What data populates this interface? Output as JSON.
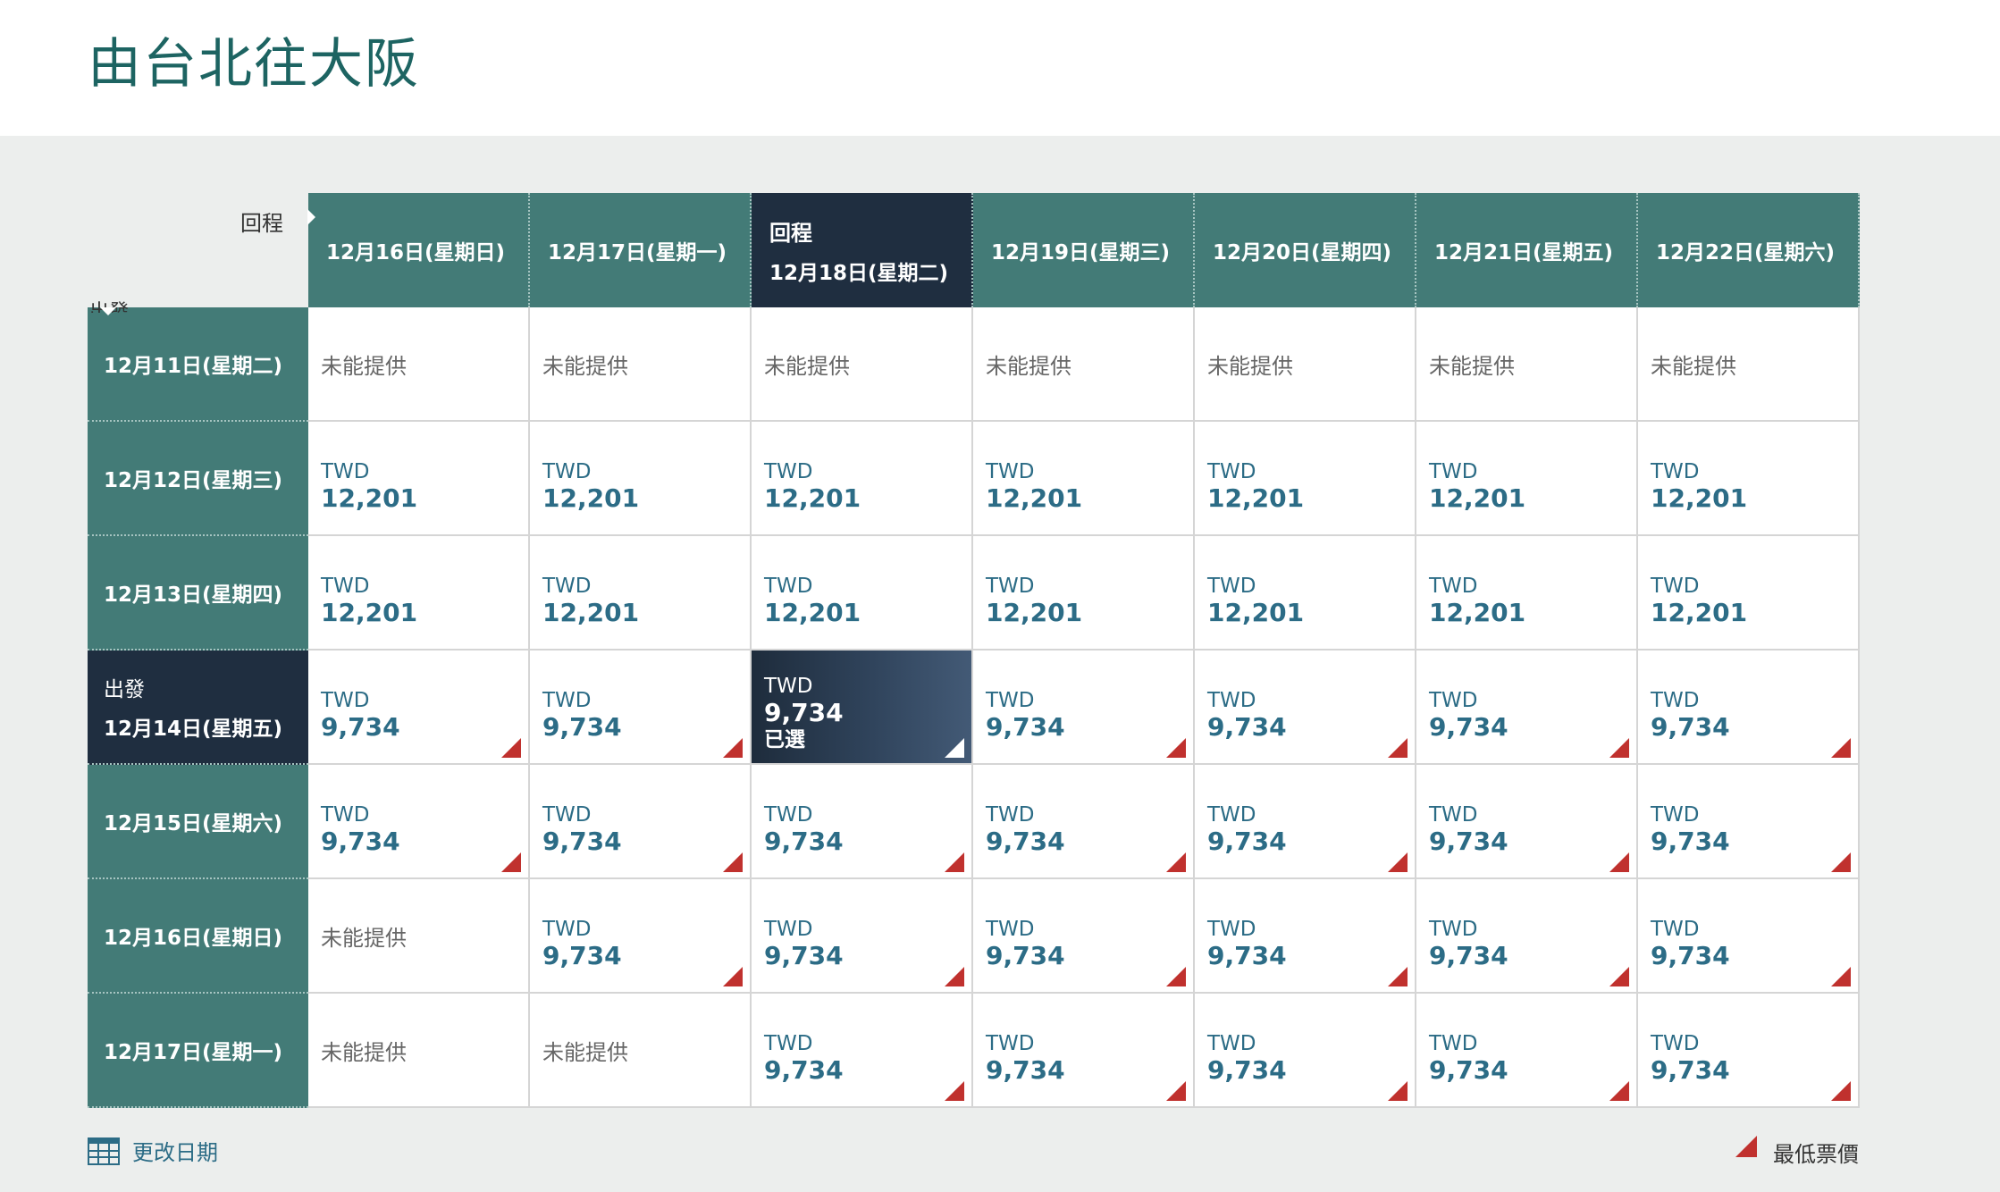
{
  "title": "由台北往大阪",
  "corner": {
    "return_label": "回程",
    "depart_label": "出發"
  },
  "return_dates": [
    {
      "date": "12月16日(星期日)",
      "selected": false
    },
    {
      "date": "12月17日(星期一)",
      "selected": false
    },
    {
      "date": "12月18日(星期二)",
      "selected": true
    },
    {
      "date": "12月19日(星期三)",
      "selected": false
    },
    {
      "date": "12月20日(星期四)",
      "selected": false
    },
    {
      "date": "12月21日(星期五)",
      "selected": false
    },
    {
      "date": "12月22日(星期六)",
      "selected": false
    }
  ],
  "selected_col_tag": "回程",
  "selected_row_tag": "出發",
  "currency": "TWD",
  "na_text": "未能提供",
  "selected_text": "已選",
  "rows": [
    {
      "date": "12月11日(星期二)",
      "selected": false,
      "cells": [
        {
          "na": true
        },
        {
          "na": true
        },
        {
          "na": true
        },
        {
          "na": true
        },
        {
          "na": true
        },
        {
          "na": true
        },
        {
          "na": true
        }
      ]
    },
    {
      "date": "12月12日(星期三)",
      "selected": false,
      "cells": [
        {
          "price": "12,201",
          "lowest": false
        },
        {
          "price": "12,201",
          "lowest": false
        },
        {
          "price": "12,201",
          "lowest": false
        },
        {
          "price": "12,201",
          "lowest": false
        },
        {
          "price": "12,201",
          "lowest": false
        },
        {
          "price": "12,201",
          "lowest": false
        },
        {
          "price": "12,201",
          "lowest": false
        }
      ]
    },
    {
      "date": "12月13日(星期四)",
      "selected": false,
      "cells": [
        {
          "price": "12,201",
          "lowest": false
        },
        {
          "price": "12,201",
          "lowest": false
        },
        {
          "price": "12,201",
          "lowest": false
        },
        {
          "price": "12,201",
          "lowest": false
        },
        {
          "price": "12,201",
          "lowest": false
        },
        {
          "price": "12,201",
          "lowest": false
        },
        {
          "price": "12,201",
          "lowest": false
        }
      ]
    },
    {
      "date": "12月14日(星期五)",
      "selected": true,
      "cells": [
        {
          "price": "9,734",
          "lowest": true
        },
        {
          "price": "9,734",
          "lowest": true
        },
        {
          "price": "9,734",
          "lowest": true,
          "selected": true
        },
        {
          "price": "9,734",
          "lowest": true
        },
        {
          "price": "9,734",
          "lowest": true
        },
        {
          "price": "9,734",
          "lowest": true
        },
        {
          "price": "9,734",
          "lowest": true
        }
      ]
    },
    {
      "date": "12月15日(星期六)",
      "selected": false,
      "cells": [
        {
          "price": "9,734",
          "lowest": true
        },
        {
          "price": "9,734",
          "lowest": true
        },
        {
          "price": "9,734",
          "lowest": true
        },
        {
          "price": "9,734",
          "lowest": true
        },
        {
          "price": "9,734",
          "lowest": true
        },
        {
          "price": "9,734",
          "lowest": true
        },
        {
          "price": "9,734",
          "lowest": true
        }
      ]
    },
    {
      "date": "12月16日(星期日)",
      "selected": false,
      "cells": [
        {
          "na": true
        },
        {
          "price": "9,734",
          "lowest": true
        },
        {
          "price": "9,734",
          "lowest": true
        },
        {
          "price": "9,734",
          "lowest": true
        },
        {
          "price": "9,734",
          "lowest": true
        },
        {
          "price": "9,734",
          "lowest": true
        },
        {
          "price": "9,734",
          "lowest": true
        }
      ]
    },
    {
      "date": "12月17日(星期一)",
      "selected": false,
      "cells": [
        {
          "na": true
        },
        {
          "na": true
        },
        {
          "price": "9,734",
          "lowest": true
        },
        {
          "price": "9,734",
          "lowest": true
        },
        {
          "price": "9,734",
          "lowest": true
        },
        {
          "price": "9,734",
          "lowest": true
        },
        {
          "price": "9,734",
          "lowest": true
        }
      ]
    }
  ],
  "footer": {
    "change_dates_label": "更改日期",
    "calendar_icon": "calendar-icon",
    "legend_label": "最低票價",
    "legend_icon": "lowest-fare-marker-icon"
  },
  "colors": {
    "header_teal": "#437b77",
    "selected_navy": "#1f2e40",
    "price_blue": "#2c6c86",
    "lowest_fare_red": "#c0312e",
    "title_green": "#1d6462"
  }
}
